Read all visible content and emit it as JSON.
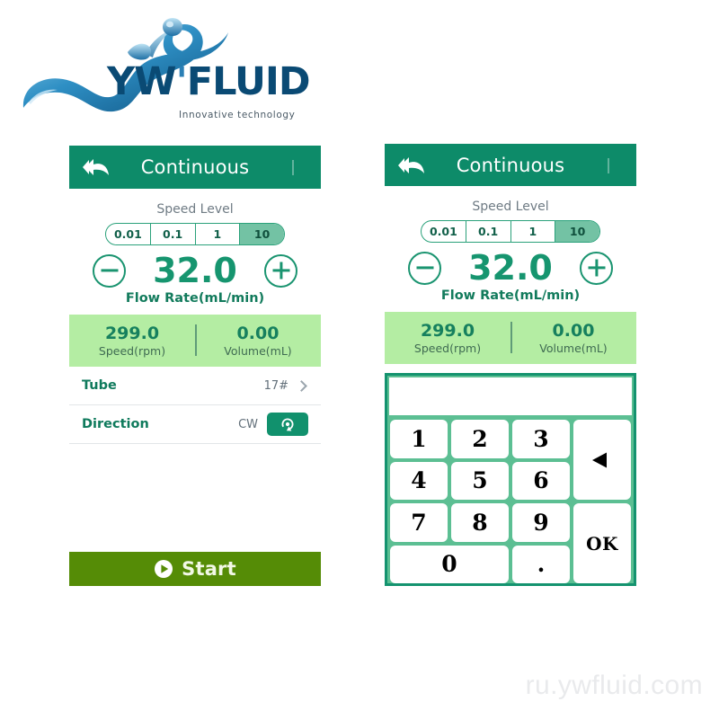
{
  "brand": {
    "name_1": "YW",
    "apostrophe": "'",
    "name_2": "FLUID",
    "tagline": "Innovative  technology",
    "logo_icon": "water-splash-logo",
    "logo_color": "#1a74a8",
    "text_color": "#0a4a74"
  },
  "watermark": "ru.ywfluid.com",
  "colors": {
    "header_green": "#0d8b69",
    "accent_green": "#16956f",
    "stats_bg": "#b4eda3",
    "start_green": "#558c06",
    "segment_selected": "#73c2a4",
    "keypad_border": "#14936f",
    "keypad_bg": "#5cbf93"
  },
  "left_panel": {
    "header": {
      "back_icon": "back-double-arrow-icon",
      "title": "Continuous",
      "menu_tick_icon": "header-tick-icon"
    },
    "speed_level": {
      "label": "Speed Level",
      "options": [
        "0.01",
        "0.1",
        "1",
        "10"
      ],
      "selected": "10",
      "selected_index": 3
    },
    "flow_rate": {
      "minus_icon": "minus-circle-icon",
      "plus_icon": "plus-circle-icon",
      "value": "32.0",
      "caption": "Flow Rate(mL/min)"
    },
    "stats": [
      {
        "value": "299.0",
        "label": "Speed(rpm)"
      },
      {
        "value": "0.00",
        "label": "Volume(mL)"
      }
    ],
    "rows": [
      {
        "key": "Tube",
        "value": "17#",
        "control": "chevron-right-icon"
      },
      {
        "key": "Direction",
        "value": "CW",
        "control": "rotate-cw-button"
      }
    ],
    "start_button": {
      "icon": "play-circle-icon",
      "label": "Start"
    }
  },
  "right_panel": {
    "header": {
      "back_icon": "back-double-arrow-icon",
      "title": "Continuous",
      "menu_tick_icon": "header-tick-icon"
    },
    "speed_level": {
      "label": "Speed Level",
      "options": [
        "0.01",
        "0.1",
        "1",
        "10"
      ],
      "selected": "10",
      "selected_index": 3
    },
    "flow_rate": {
      "minus_icon": "minus-circle-icon",
      "plus_icon": "plus-circle-icon",
      "value": "32.0",
      "caption": "Flow Rate(mL/min)"
    },
    "stats": [
      {
        "value": "299.0",
        "label": "Speed(rpm)"
      },
      {
        "value": "0.00",
        "label": "Volume(mL)"
      }
    ],
    "keypad": {
      "display_value": "",
      "keys": [
        {
          "label": "1",
          "name": "key-1"
        },
        {
          "label": "2",
          "name": "key-2"
        },
        {
          "label": "3",
          "name": "key-3"
        },
        {
          "label": "4",
          "name": "key-4"
        },
        {
          "label": "5",
          "name": "key-5"
        },
        {
          "label": "6",
          "name": "key-6"
        },
        {
          "label": "7",
          "name": "key-7"
        },
        {
          "label": "8",
          "name": "key-8"
        },
        {
          "label": "9",
          "name": "key-9"
        },
        {
          "label": "0",
          "name": "key-0"
        },
        {
          "label": ".",
          "name": "key-decimal"
        }
      ],
      "backspace_icon": "backspace-left-triangle-icon",
      "ok_label": "OK"
    }
  }
}
